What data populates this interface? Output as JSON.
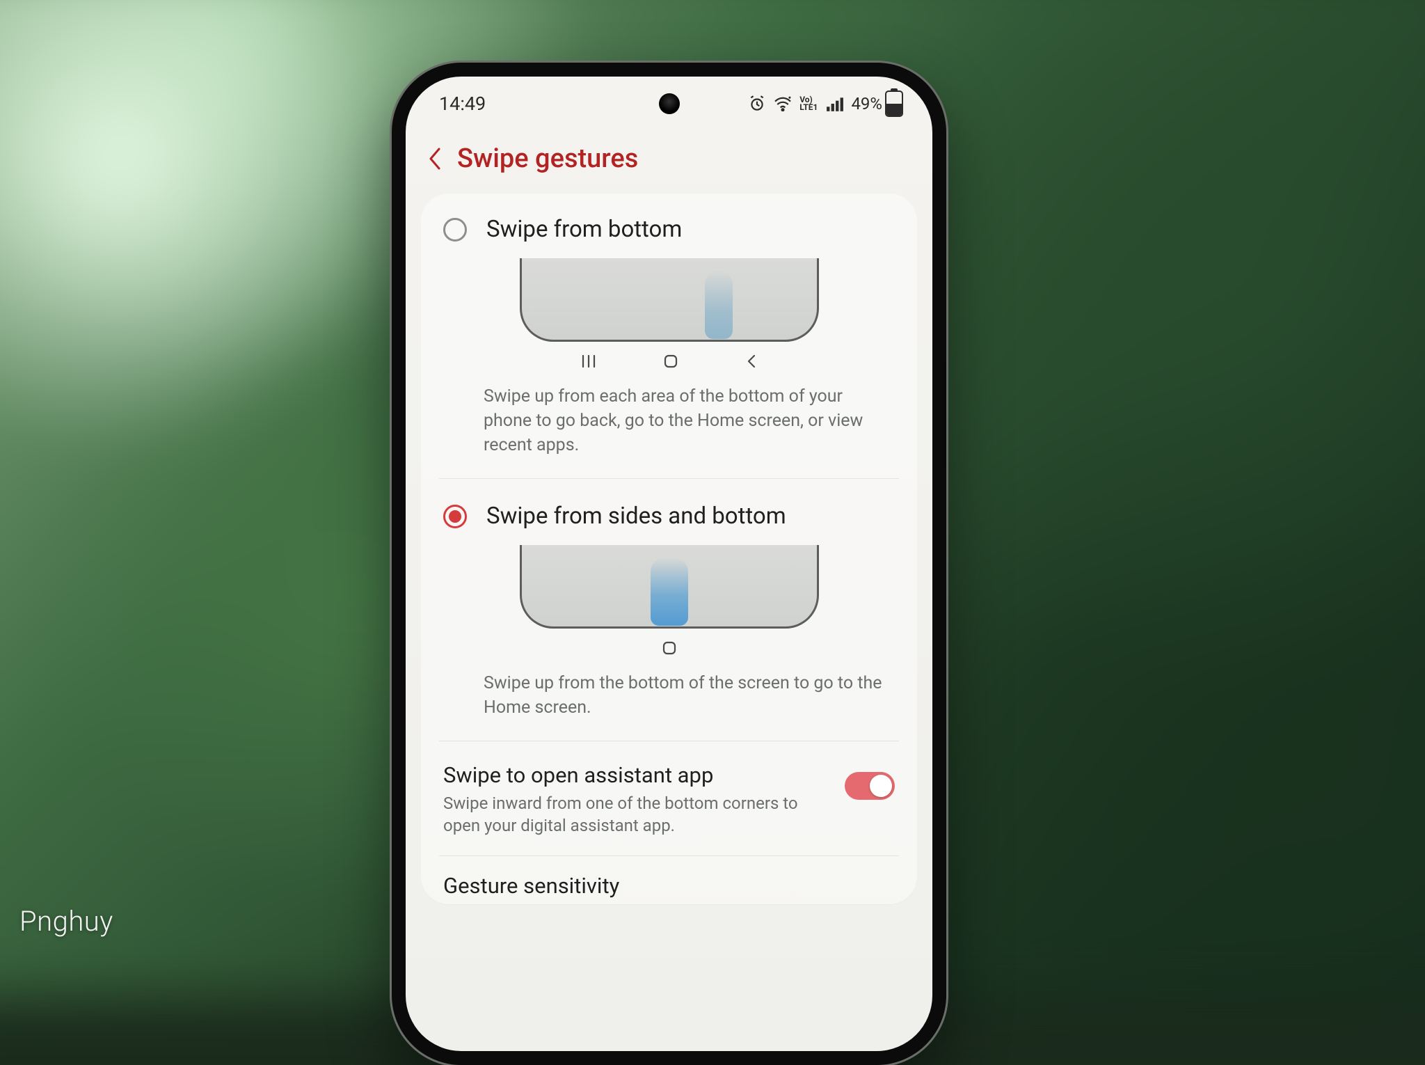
{
  "watermark": "Pnghuy",
  "statusbar": {
    "time": "14:49",
    "battery_text": "49%",
    "battery_level": 49
  },
  "header": {
    "title": "Swipe gestures"
  },
  "options": [
    {
      "label": "Swipe from bottom",
      "description": "Swipe up from each area of the bottom of your phone to go back, go to the Home screen, or view recent apps.",
      "selected": false
    },
    {
      "label": "Swipe from sides and bottom",
      "description": "Swipe up from the bottom of the screen to go to the Home screen.",
      "selected": true
    }
  ],
  "assistant": {
    "title": "Swipe to open assistant app",
    "sub": "Swipe inward from one of the bottom corners to open your digital assistant app.",
    "enabled": true
  },
  "sensitivity": {
    "title": "Gesture sensitivity"
  }
}
